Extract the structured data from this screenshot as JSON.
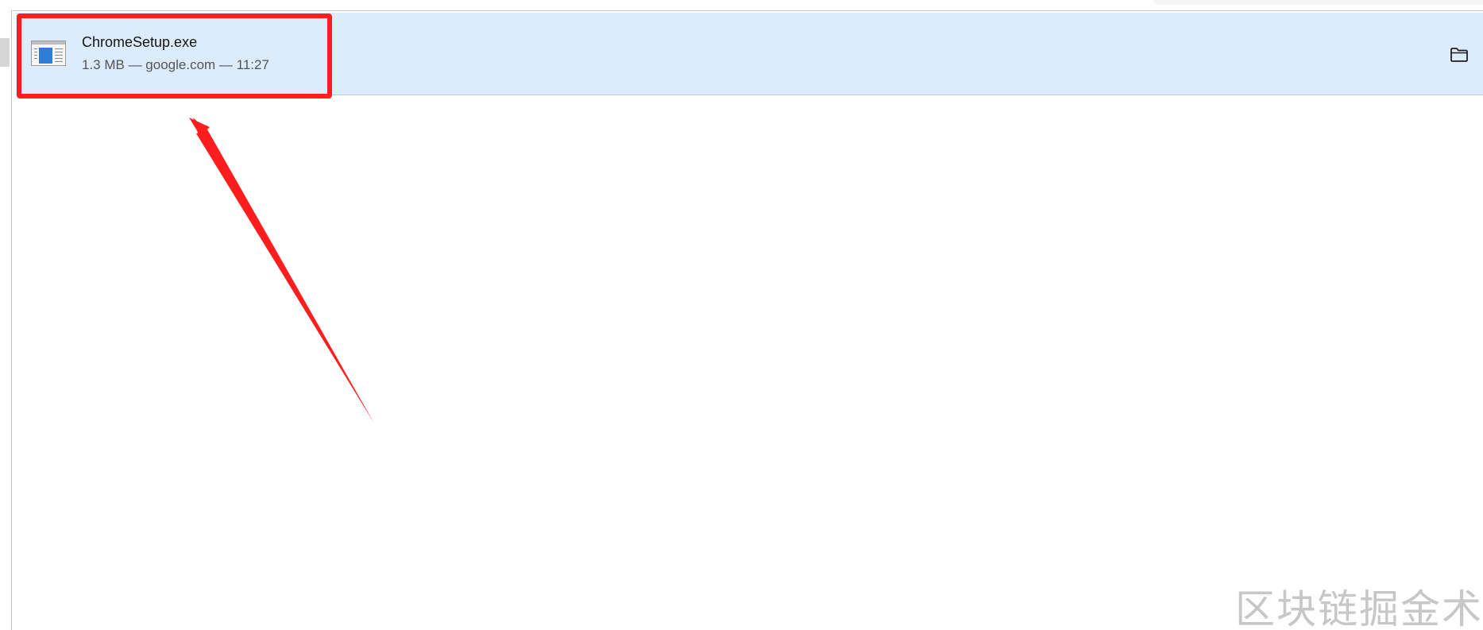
{
  "download": {
    "file_name": "ChromeSetup.exe",
    "meta": "1.3 MB — google.com — 11:27",
    "file_icon": "exe-file-icon",
    "action_icon": "folder-icon"
  },
  "annotation": {
    "color": "#ff1d1d"
  },
  "watermark": {
    "text": "区块链掘金术"
  },
  "colors": {
    "row_background": "#dcecfd",
    "row_border": "#aecdf0"
  }
}
